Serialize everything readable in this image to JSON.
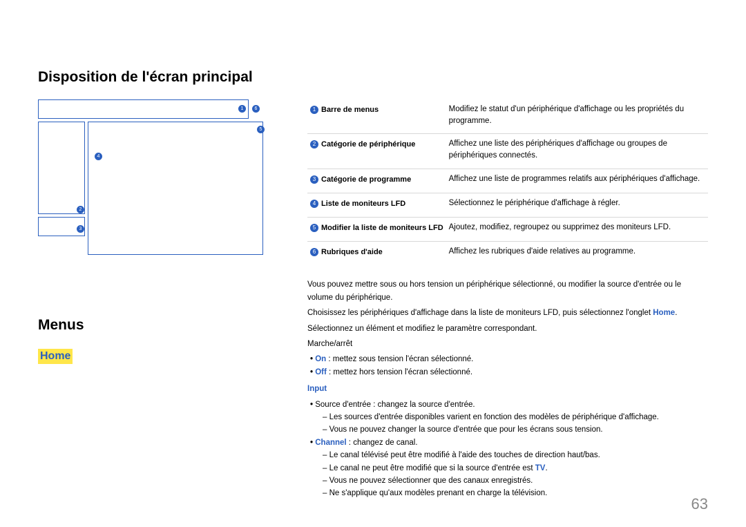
{
  "page_title": "Disposition de l'écran principal",
  "diagram": {
    "n1": "1",
    "n2": "2",
    "n3": "3",
    "n4": "4",
    "n5": "5",
    "n6": "6"
  },
  "legend": {
    "items": [
      {
        "num": "1",
        "label": "Barre de menus",
        "desc": "Modifiez le statut d'un périphérique d'affichage ou les propriétés du programme."
      },
      {
        "num": "2",
        "label": "Catégorie de périphérique",
        "desc": "Affichez une liste des périphériques d'affichage ou groupes de périphériques connectés."
      },
      {
        "num": "3",
        "label": "Catégorie de programme",
        "desc": "Affichez une liste de programmes relatifs aux périphériques d'affichage."
      },
      {
        "num": "4",
        "label": "Liste de moniteurs LFD",
        "desc": "Sélectionnez le périphérique d'affichage à régler."
      },
      {
        "num": "5",
        "label": "Modifier la liste de moniteurs LFD",
        "desc": "Ajoutez, modifiez, regroupez ou supprimez des moniteurs LFD."
      },
      {
        "num": "6",
        "label": "Rubriques d'aide",
        "desc": "Affichez les rubriques d'aide relatives au programme."
      }
    ]
  },
  "menus_heading": "Menus",
  "home_heading": "Home",
  "lower": {
    "p1": "Vous pouvez mettre sous ou hors tension un périphérique sélectionné, ou modifier la source d'entrée ou le volume du périphérique.",
    "p2_pre": "Choisissez les périphériques d'affichage dans la liste de moniteurs LFD, puis sélectionnez l'onglet ",
    "p2_home": "Home",
    "p2_post": ".",
    "p3": "Sélectionnez un élément et modifiez le paramètre correspondant.",
    "p4": "Marche/arrêt",
    "on_label": "On",
    "on_text": " : mettez sous tension l'écran sélectionné.",
    "off_label": "Off",
    "off_text": " : mettez hors tension l'écran sélectionné.",
    "input_heading": "Input",
    "src_text": "Source d'entrée : changez la source d'entrée.",
    "src_d1": "Les sources d'entrée disponibles varient en fonction des modèles de périphérique d'affichage.",
    "src_d2": "Vous ne pouvez changer la source d'entrée que pour les écrans sous tension.",
    "channel_label": "Channel",
    "channel_text": " : changez de canal.",
    "ch_d1": "Le canal télévisé peut être modifié à l'aide des touches de direction haut/bas.",
    "ch_d2_pre": "Le canal ne peut être modifié que si la source d'entrée est ",
    "ch_d2_tv": "TV",
    "ch_d2_post": ".",
    "ch_d3": "Vous ne pouvez sélectionner que des canaux enregistrés.",
    "ch_d4": "Ne s'applique qu'aux modèles prenant en charge la télévision."
  },
  "page_number": "63"
}
